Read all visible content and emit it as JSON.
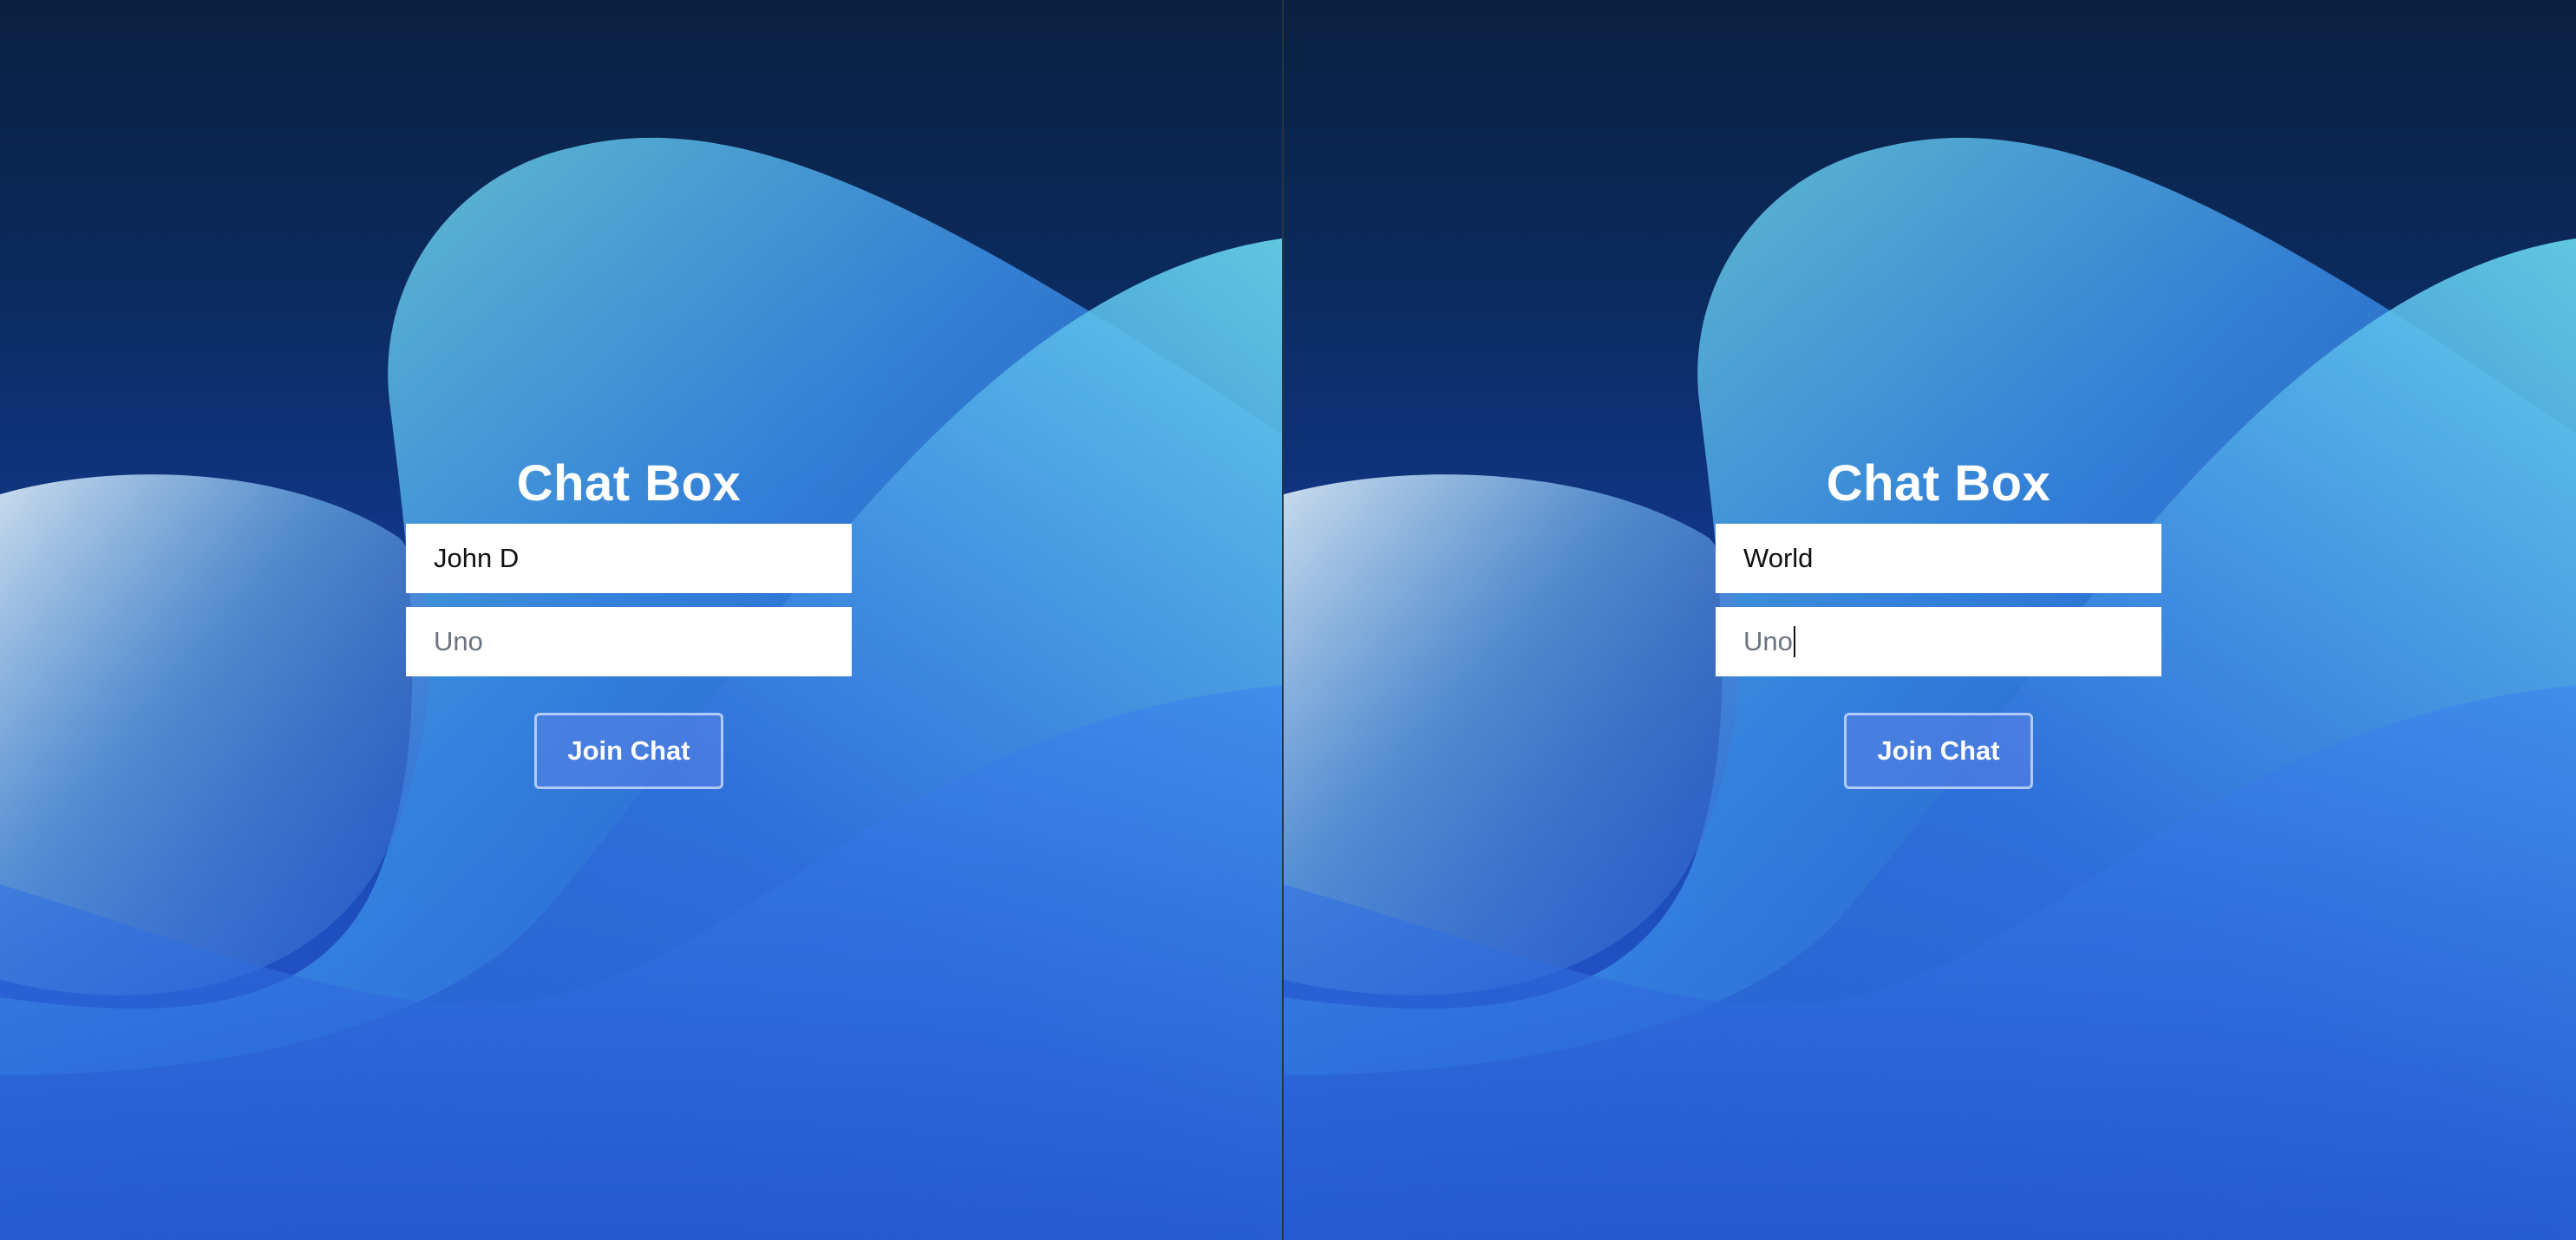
{
  "panes": [
    {
      "title": "Chat Box",
      "name_input": {
        "value": "John D"
      },
      "room_input": {
        "placeholder": "Uno"
      },
      "join_button": "Join Chat"
    },
    {
      "title": "Chat Box",
      "name_input": {
        "value": "World"
      },
      "room_input": {
        "placeholder": "Uno"
      },
      "join_button": "Join Chat"
    }
  ],
  "colors": {
    "background_top": "#0a2040",
    "background_bottom": "#2456cc",
    "wave_highlight": "#6fe0d8",
    "button_border": "#d7e4ff"
  }
}
